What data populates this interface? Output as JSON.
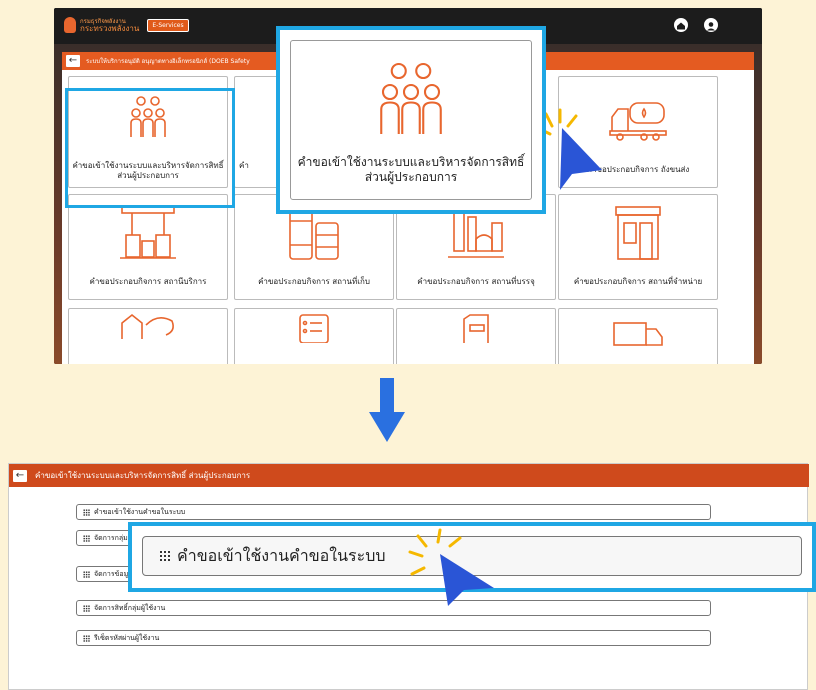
{
  "step1": {
    "header": {
      "org_line1": "กรมธุรกิจพลังงาน",
      "org_line2": "กระทรวงพลังงาน",
      "eservices_label": "E-Services",
      "home_icon": "home-icon",
      "user_icon": "user-circle-icon"
    },
    "panel_title": "ระบบให้บริการอนุมัติ อนุญาตทางอิเล็กทรอนิกส์ (DOEB Safety",
    "tiles": [
      {
        "label": "คำขอเข้าใช้งานระบบและบริหารจัดการสิทธิ์ ส่วนผู้ประกอบการ",
        "icon": "people-group-icon"
      },
      {
        "label": "คำ",
        "icon": ""
      },
      {
        "label": "คำขอประกอบกิจการ ถังขนส่ง",
        "icon": "tanker-truck-icon"
      },
      {
        "label": "คำขอประกอบกิจการ สถานีบริการ",
        "icon": "gas-station-icon"
      },
      {
        "label": "คำขอประกอบกิจการ สถานที่เก็บ",
        "icon": "oil-barrels-icon"
      },
      {
        "label": "คำขอประกอบกิจการ สถานที่บรรจุ",
        "icon": "refinery-icon"
      },
      {
        "label": "คำขอประกอบกิจการ สถานที่จำหน่าย",
        "icon": "shop-icon"
      }
    ],
    "zoom_label": "คำขอเข้าใช้งานระบบและบริหารจัดการสิทธิ์ ส่วนผู้ประกอบการ"
  },
  "step2": {
    "title": "คำขอเข้าใช้งานระบบและบริหารจัดการสิทธิ์ ส่วนผู้ประกอบการ",
    "menu_items": [
      "คำขอเข้าใช้งานคำขอในระบบ",
      "จัดการกลุ่ม",
      "จัดการข้อมู",
      "จัดการสิทธิ์กลุ่มผู้ใช้งาน",
      "รีเซ็ตรหัสผ่านผู้ใช้งาน"
    ],
    "zoom_label": "คำขอเข้าใช้งานคำขอในระบบ"
  },
  "colors": {
    "accent": "#e8662e",
    "header": "#e45b21",
    "highlight": "#1fa7e4",
    "cursor": "#2a55d6"
  }
}
